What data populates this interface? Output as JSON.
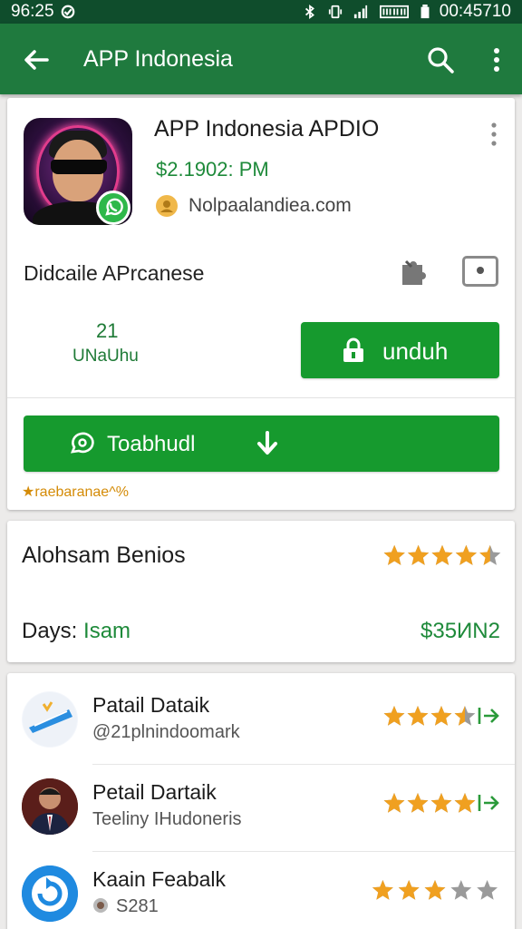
{
  "status_bar": {
    "left_time": "96:25",
    "right_time": "00:45710"
  },
  "app_bar": {
    "title": "APP Indonesia"
  },
  "app": {
    "title": "APP Indonesia APDIO",
    "price": "$2.1902: PM",
    "developer": "Nolpaalandiea.com",
    "description": "Didcaile APrcanese",
    "stat_number": "21",
    "stat_label": "UNaUhu",
    "unduh_button": "unduh",
    "main_button": "Toabhudl",
    "rating_note": "★raebaranae^%"
  },
  "summary": {
    "title": "Alohsam Benios",
    "rating": 4.5,
    "days_label": "Days:",
    "days_value": "Isam",
    "price": "$35ИN2"
  },
  "reviews": [
    {
      "name": "Patail Dataik",
      "sub": "@21plnindoomark",
      "rating": 3.5,
      "avatar": "blue-pen"
    },
    {
      "name": "Petail Dartaik",
      "sub": "Teeliny IHudoneris",
      "rating": 4,
      "avatar": "person"
    },
    {
      "name": "Kaain Feabalk",
      "sub": "S281",
      "rating": 3,
      "avatar": "refresh"
    }
  ],
  "colors": {
    "status_bar": "#0f4d2c",
    "app_bar": "#1f7a3e",
    "button_green": "#169a2e",
    "accent_green": "#1e8a3a",
    "star_orange": "#f0a020",
    "star_gray": "#9a9a9a"
  }
}
